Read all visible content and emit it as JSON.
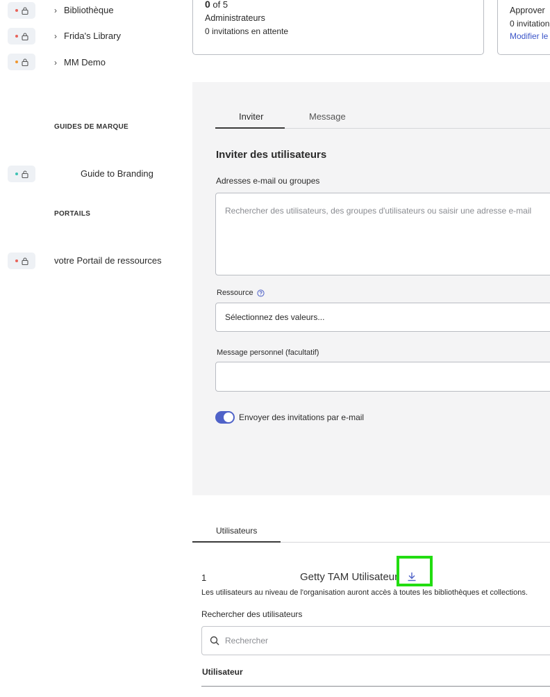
{
  "sidebar": {
    "libraries": [
      {
        "label": "Bibliothèque",
        "dot_color": "#e8635a"
      },
      {
        "label": "Frida's Library",
        "dot_color": "#e8635a"
      },
      {
        "label": "MM Demo",
        "dot_color": "#f0962e"
      }
    ],
    "brand_heading": "GUIDES DE MARQUE",
    "brand_item": {
      "label": "Guide to Branding",
      "dot_color": "#3fc2b4"
    },
    "portals_heading": "PORTAILS",
    "portal_item": {
      "label": "votre Portail de ressources",
      "dot_color": "#e8635a"
    }
  },
  "cards": {
    "admins": {
      "count": "0",
      "of_total": "of 5",
      "label": "Administrateurs",
      "pending": "0 invitations en attente"
    },
    "approver": {
      "title": "Approver",
      "pending": "0 invitation",
      "edit_link": "Modifier le"
    }
  },
  "invite": {
    "tabs": [
      "Inviter",
      "Message"
    ],
    "title": "Inviter des utilisateurs",
    "emails_label": "Adresses e-mail ou groupes",
    "emails_placeholder": "Rechercher des utilisateurs, des groupes d'utilisateurs ou saisir une adresse e-mail",
    "resource_label": "Ressource",
    "resource_placeholder": "Sélectionnez des valeurs...",
    "message_label": "Message personnel (facultatif)",
    "send_email_label": "Envoyer des invitations par e-mail",
    "send_email_on": true
  },
  "users": {
    "tab": "Utilisateurs",
    "count": "1",
    "org_name": "Getty TAM Utilisateur",
    "description": "Les utilisateurs au niveau de l'organisation auront accès à toutes les bibliothèques et collections.",
    "search_label": "Rechercher des utilisateurs",
    "search_placeholder": "Rechercher",
    "column_user": "Utilisateur"
  },
  "colors": {
    "accent": "#4f62c8",
    "highlight": "#22dd11",
    "link": "#3b55c8"
  }
}
